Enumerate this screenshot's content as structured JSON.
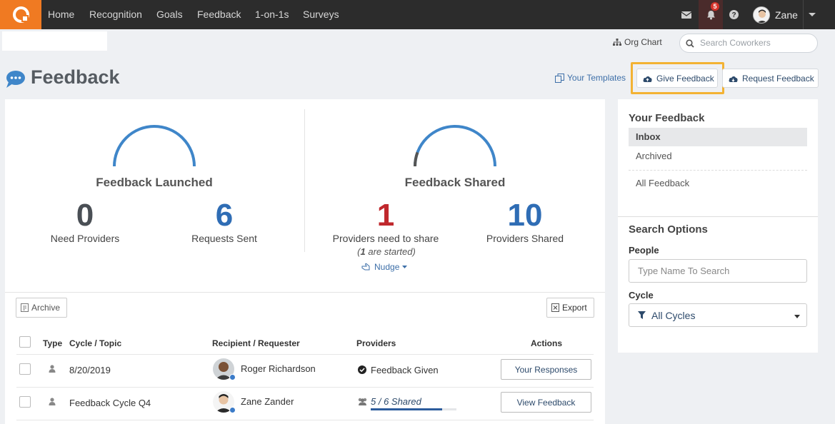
{
  "nav": {
    "links": [
      "Home",
      "Recognition",
      "Goals",
      "Feedback",
      "1-on-1s",
      "Surveys"
    ],
    "notification_count": "5",
    "user_name": "Zane"
  },
  "subbar": {
    "org_chart": "Org Chart",
    "search_placeholder": "Search Coworkers"
  },
  "page": {
    "title": "Feedback",
    "your_templates": "Your Templates",
    "give_feedback": "Give Feedback",
    "request_feedback": "Request Feedback"
  },
  "stats": {
    "launched": {
      "title": "Feedback Launched",
      "need_providers": "0",
      "need_providers_label": "Need Providers",
      "requests_sent": "6",
      "requests_sent_label": "Requests Sent"
    },
    "shared": {
      "title": "Feedback Shared",
      "need_to_share": "1",
      "need_to_share_label": "Providers need to share",
      "started_count": "1",
      "started_text": " are started)",
      "providers_shared": "10",
      "providers_shared_label": "Providers Shared",
      "nudge": "Nudge"
    },
    "colors": {
      "dark": "#4a4f55",
      "blue": "#2f6db5",
      "red": "#c0282d",
      "gauge_blue": "#3f86c9"
    }
  },
  "toolbar": {
    "archive": "Archive",
    "export": "Export"
  },
  "table": {
    "headers": {
      "type": "Type",
      "cycle": "Cycle / Topic",
      "recipient": "Recipient / Requester",
      "providers": "Providers",
      "actions": "Actions"
    },
    "rows": [
      {
        "cycle": "8/20/2019",
        "recipient": "Roger Richardson",
        "providers": "Feedback Given",
        "action": "Your Responses"
      },
      {
        "cycle": "Feedback Cycle Q4",
        "recipient": "Zane Zander",
        "providers": "5 / 6 Shared",
        "shared_fraction": 0.83,
        "action": "View Feedback"
      }
    ]
  },
  "sidebar": {
    "your_feedback": "Your Feedback",
    "items": [
      "Inbox",
      "Archived",
      "All Feedback"
    ],
    "search_options": "Search Options",
    "people_label": "People",
    "people_placeholder": "Type Name To Search",
    "cycle_label": "Cycle",
    "cycle_value": "All Cycles"
  }
}
